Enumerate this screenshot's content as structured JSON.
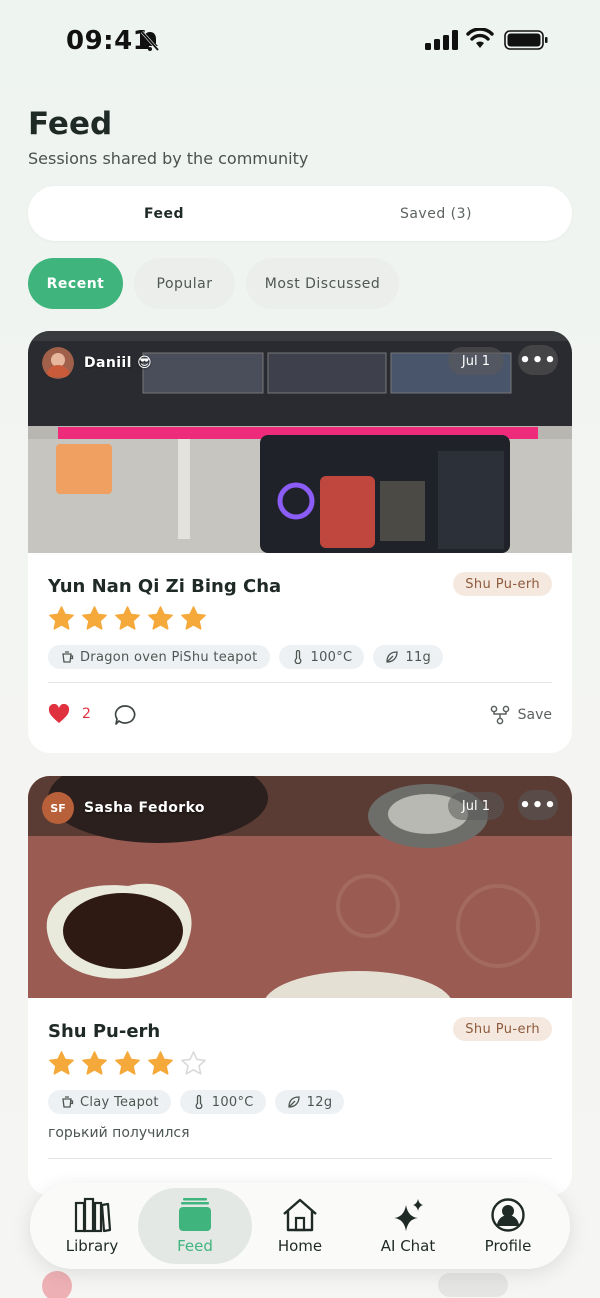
{
  "status_bar": {
    "time": "09:41"
  },
  "header": {
    "title": "Feed",
    "subtitle": "Sessions shared by the community"
  },
  "segments": {
    "feed": "Feed",
    "saved": "Saved (3)"
  },
  "filters": [
    "Recent",
    "Popular",
    "Most Discussed"
  ],
  "posts": [
    {
      "author": "Daniil 😎",
      "date": "Jul 1",
      "tea": "Yun Nan Qi Zi Bing Cha",
      "type": "Shu Pu-erh",
      "rating": 5,
      "vessel": "Dragon oven PiShu teapot",
      "temperature": "100°C",
      "amount": "11g",
      "likes": "2",
      "save_label": "Save"
    },
    {
      "author": "Sasha Fedorko",
      "initials": "SF",
      "date": "Jul 1",
      "tea": "Shu Pu-erh",
      "type": "Shu Pu-erh",
      "rating": 4,
      "vessel": "Clay Teapot",
      "temperature": "100°C",
      "amount": "12g",
      "note": "горький получился"
    }
  ],
  "more_label": "•••",
  "tab_bar": [
    "Library",
    "Feed",
    "Home",
    "AI Chat",
    "Profile"
  ],
  "colors": {
    "accent": "#3fb57d",
    "star": "#f5a93a",
    "like": "#e0313f",
    "badge_bg": "#f5e9df",
    "badge_text": "#8d5a3d"
  },
  "icons": {
    "status": [
      "bell-slash-icon",
      "signal-icon",
      "wifi-icon",
      "battery-icon"
    ],
    "tags": [
      "teapot-icon",
      "thermometer-icon",
      "leaf-icon"
    ],
    "actions": [
      "heart-icon",
      "comment-icon",
      "save-icon"
    ],
    "tabs": [
      "library-icon",
      "feed-icon",
      "home-icon",
      "sparkles-icon",
      "profile-icon"
    ]
  }
}
